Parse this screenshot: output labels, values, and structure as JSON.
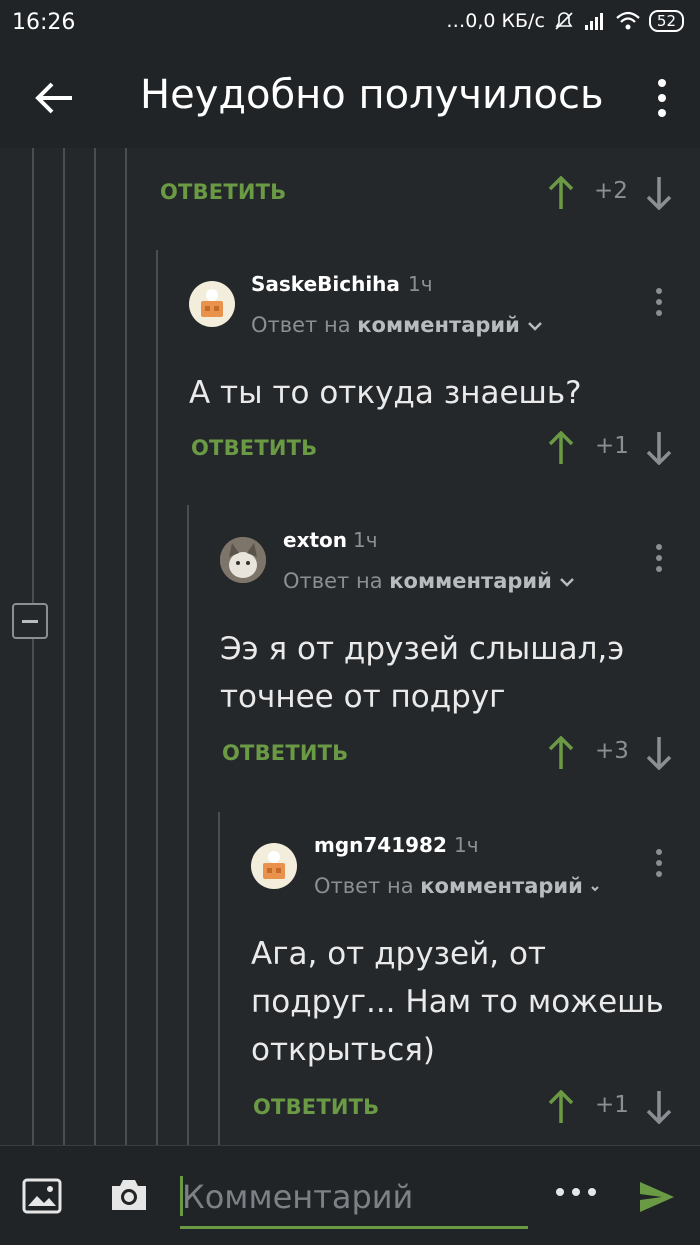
{
  "status_bar": {
    "time": "16:26",
    "network": "0,0 КБ/с",
    "battery": "52"
  },
  "app_bar": {
    "title": "Неудобно получилось",
    "back_icon": "arrow-left-icon",
    "menu_icon": "more-vert-icon"
  },
  "colors": {
    "background": "#25282b",
    "accent_green": "#6b9a45",
    "muted": "#8b8f93"
  },
  "comments": [
    {
      "id": "c0",
      "reply_label": "ОТВЕТИТЬ",
      "score": "+2"
    },
    {
      "id": "c1",
      "author": "SaskeBichiha",
      "ago": "1ч",
      "reply_to_prefix": "Ответ на",
      "reply_to_link": "комментарий",
      "text": "А ты то откуда знаешь?",
      "reply_label": "ОТВЕТИТЬ",
      "score": "+1"
    },
    {
      "id": "c2",
      "author": "exton",
      "ago": "1ч",
      "reply_to_prefix": "Ответ на",
      "reply_to_link": "комментарий",
      "text": "Ээ я от друзей слышал,э точнее от подруг",
      "reply_label": "ОТВЕТИТЬ",
      "score": "+3"
    },
    {
      "id": "c3",
      "author": "mgn741982",
      "ago": "1ч",
      "reply_to_prefix": "Ответ на",
      "reply_to_link": "комментарий",
      "text": "Ага, от друзей, от подруг... Нам то можешь открыться)",
      "reply_label": "ОТВЕТИТЬ",
      "score": "+1"
    }
  ],
  "composer": {
    "placeholder": "Комментарий",
    "image_icon": "image-icon",
    "camera_icon": "camera-icon",
    "more_icon": "more-horiz-icon",
    "send_icon": "send-icon"
  }
}
